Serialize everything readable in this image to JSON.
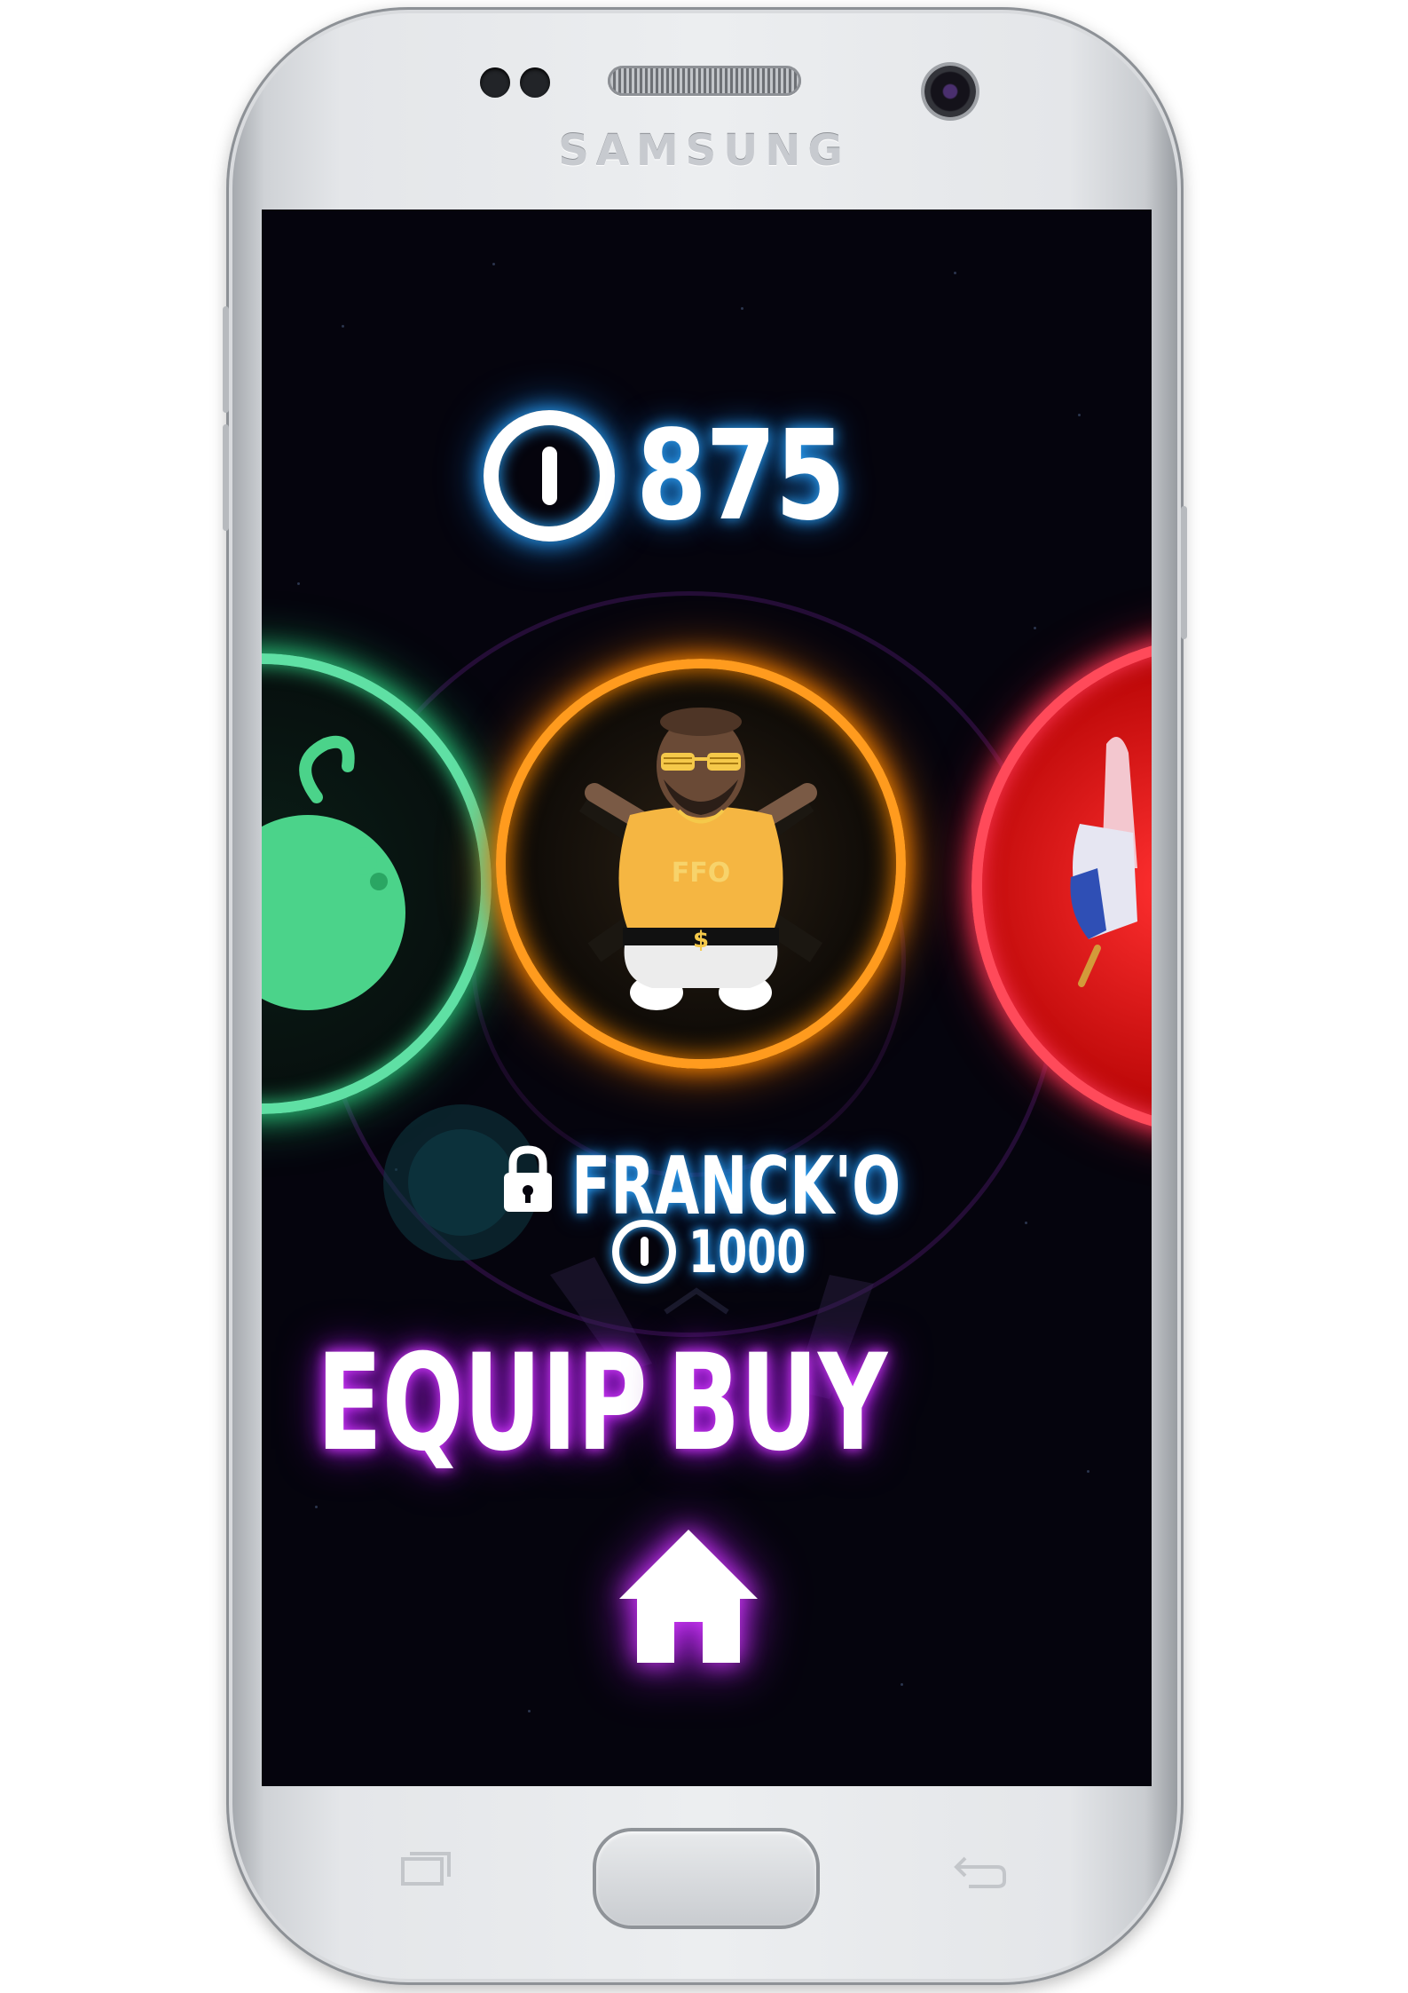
{
  "device": {
    "brand": "SAMSUNG"
  },
  "hud": {
    "coin_total": "875",
    "coin_icon": "coin-icon"
  },
  "shop": {
    "selected_item": {
      "name": "FRANCK'O",
      "price": "1000",
      "locked": true,
      "lock_icon": "lock-icon"
    },
    "characters": [
      {
        "position": "left",
        "color": "#5fe0a4"
      },
      {
        "position": "center",
        "color": "#ff9b1e",
        "label": "FFO",
        "belt": "$"
      },
      {
        "position": "right",
        "color": "#ff4a5a"
      }
    ],
    "equip_label": "EQUIP",
    "buy_label": "BUY"
  },
  "nav": {
    "home_icon": "home-icon"
  },
  "colors": {
    "coin_glow": "#2ea8ff",
    "button_glow": "#d63cff",
    "screen_bg": "#05040d"
  }
}
